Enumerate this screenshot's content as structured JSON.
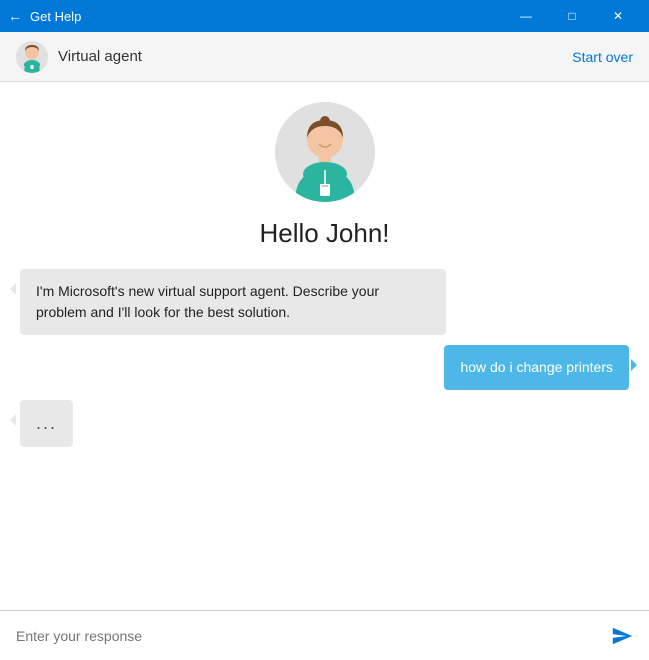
{
  "titleBar": {
    "title": "Get Help",
    "backIcon": "←",
    "minimizeIcon": "—",
    "maximizeIcon": "□",
    "closeIcon": "✕"
  },
  "header": {
    "agentName": "Virtual agent",
    "startOverLabel": "Start over"
  },
  "chat": {
    "greeting": "Hello John!",
    "agentMessage": "I'm Microsoft's new virtual support agent. Describe your problem and I'll look for the best solution.",
    "userMessage": "how do i change printers",
    "typingIndicator": "...",
    "inputPlaceholder": "Enter your response"
  }
}
